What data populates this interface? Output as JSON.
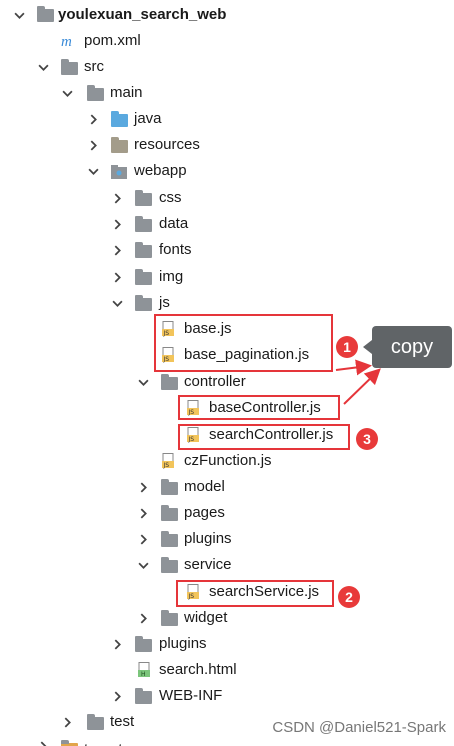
{
  "tree": {
    "project": "youlexuan_search_web",
    "pom": "pom.xml",
    "src": "src",
    "main": "main",
    "java": "java",
    "resources": "resources",
    "webapp": "webapp",
    "css": "css",
    "data": "data",
    "fonts": "fonts",
    "img": "img",
    "js": "js",
    "base_js": "base.js",
    "base_pagination_js": "base_pagination.js",
    "controller": "controller",
    "base_controller_js": "baseController.js",
    "search_controller_js": "searchController.js",
    "cz_function_js": "czFunction.js",
    "model": "model",
    "pages": "pages",
    "plugins_inner": "plugins",
    "service": "service",
    "search_service_js": "searchService.js",
    "widget": "widget",
    "plugins_outer": "plugins",
    "search_html": "search.html",
    "web_inf": "WEB-INF",
    "test": "test",
    "cut_off_item": "target"
  },
  "annotations": {
    "badge_1": "1",
    "badge_2": "2",
    "badge_3": "3",
    "tooltip": "copy"
  },
  "watermark": "CSDN @Daniel521-Spark",
  "colors": {
    "highlight": "#e5353a",
    "folder": "#8e9398",
    "source_folder": "#5aa9df",
    "tooltip_bg": "#606467"
  }
}
